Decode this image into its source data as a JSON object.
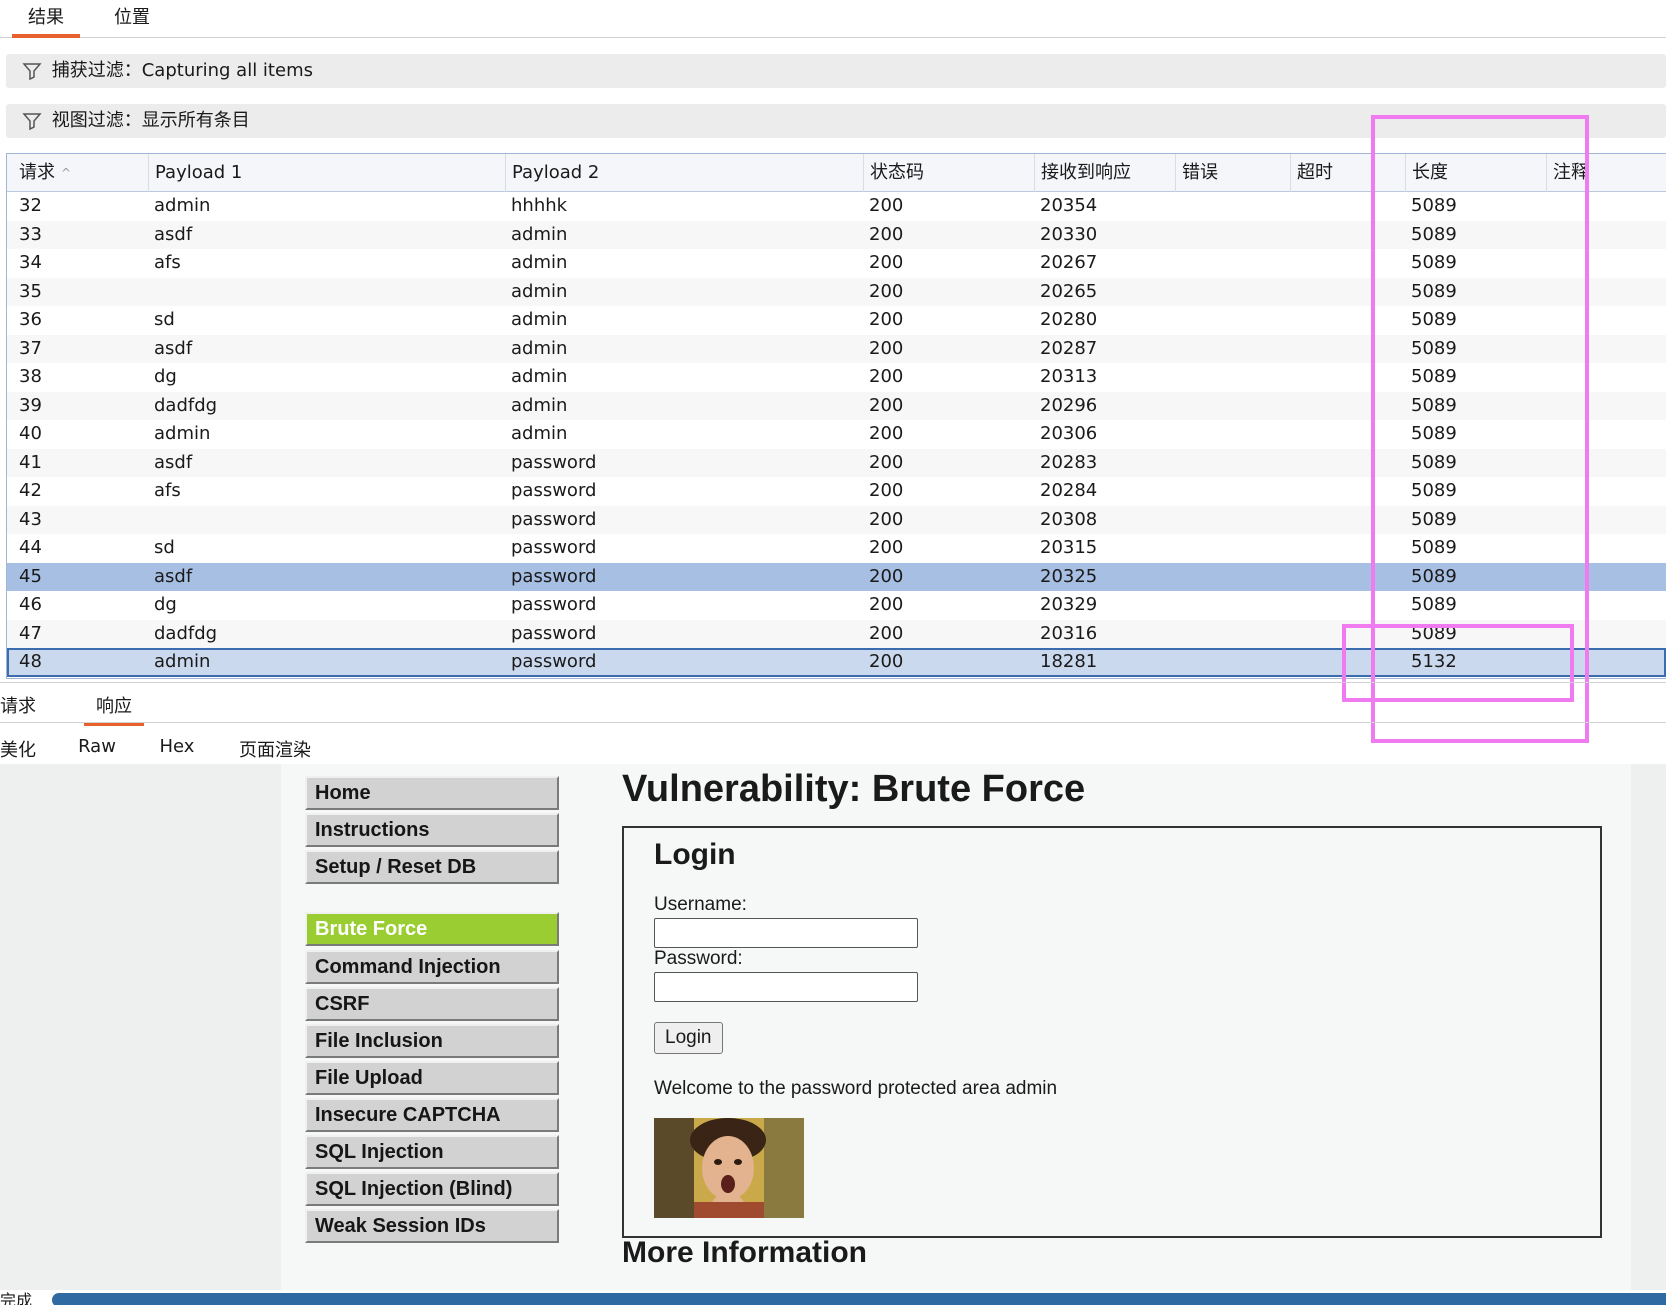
{
  "top_tabs": [
    {
      "label": "结果",
      "active": true
    },
    {
      "label": "位置",
      "active": false
    }
  ],
  "filters": {
    "capture": "捕获过滤：Capturing all items",
    "view": "视图过滤：显示所有条目"
  },
  "table": {
    "columns": [
      "请求",
      "Payload 1",
      "Payload 2",
      "状态码",
      "接收到响应",
      "错误",
      "超时",
      "长度",
      "注释"
    ],
    "sort_indicator": "^",
    "rows": [
      {
        "req": "32",
        "p1": "admin",
        "p2": "hhhhk",
        "status": "200",
        "resp": "20354",
        "len": "5089"
      },
      {
        "req": "33",
        "p1": "asdf",
        "p2": "admin",
        "status": "200",
        "resp": "20330",
        "len": "5089"
      },
      {
        "req": "34",
        "p1": "afs",
        "p2": "admin",
        "status": "200",
        "resp": "20267",
        "len": "5089"
      },
      {
        "req": "35",
        "p1": "",
        "p2": "admin",
        "status": "200",
        "resp": "20265",
        "len": "5089"
      },
      {
        "req": "36",
        "p1": "sd",
        "p2": "admin",
        "status": "200",
        "resp": "20280",
        "len": "5089"
      },
      {
        "req": "37",
        "p1": "asdf",
        "p2": "admin",
        "status": "200",
        "resp": "20287",
        "len": "5089"
      },
      {
        "req": "38",
        "p1": "dg",
        "p2": "admin",
        "status": "200",
        "resp": "20313",
        "len": "5089"
      },
      {
        "req": "39",
        "p1": "dadfdg",
        "p2": "admin",
        "status": "200",
        "resp": "20296",
        "len": "5089"
      },
      {
        "req": "40",
        "p1": "admin",
        "p2": "admin",
        "status": "200",
        "resp": "20306",
        "len": "5089"
      },
      {
        "req": "41",
        "p1": "asdf",
        "p2": "password",
        "status": "200",
        "resp": "20283",
        "len": "5089"
      },
      {
        "req": "42",
        "p1": "afs",
        "p2": "password",
        "status": "200",
        "resp": "20284",
        "len": "5089"
      },
      {
        "req": "43",
        "p1": "",
        "p2": "password",
        "status": "200",
        "resp": "20308",
        "len": "5089"
      },
      {
        "req": "44",
        "p1": "sd",
        "p2": "password",
        "status": "200",
        "resp": "20315",
        "len": "5089"
      },
      {
        "req": "45",
        "p1": "asdf",
        "p2": "password",
        "status": "200",
        "resp": "20325",
        "len": "5089",
        "state": "selected"
      },
      {
        "req": "46",
        "p1": "dg",
        "p2": "password",
        "status": "200",
        "resp": "20329",
        "len": "5089"
      },
      {
        "req": "47",
        "p1": "dadfdg",
        "p2": "password",
        "status": "200",
        "resp": "20316",
        "len": "5089"
      },
      {
        "req": "48",
        "p1": "admin",
        "p2": "password",
        "status": "200",
        "resp": "18281",
        "len": "5132",
        "state": "focused"
      }
    ]
  },
  "pane_tabs": [
    {
      "label": "请求",
      "active": false
    },
    {
      "label": "响应",
      "active": true
    }
  ],
  "view_tabs": [
    {
      "label": "美化",
      "active": false
    },
    {
      "label": "Raw",
      "active": false
    },
    {
      "label": "Hex",
      "active": false
    },
    {
      "label": "页面渲染",
      "active": true
    }
  ],
  "rendered_page": {
    "title": "Vulnerability: Brute Force",
    "menu": [
      "Home",
      "Instructions",
      "Setup / Reset DB",
      "Brute Force",
      "Command Injection",
      "CSRF",
      "File Inclusion",
      "File Upload",
      "Insecure CAPTCHA",
      "SQL Injection",
      "SQL Injection (Blind)",
      "Weak Session IDs"
    ],
    "active_menu": "Brute Force",
    "login": {
      "heading": "Login",
      "username_label": "Username:",
      "password_label": "Password:",
      "button": "Login",
      "welcome": "Welcome to the password protected area admin"
    },
    "more_heading": "More Information"
  },
  "status": {
    "text": "完成"
  },
  "colors": {
    "accent": "#e8602c",
    "highlight": "#f07af0",
    "active_menu": "#9acd32",
    "selected_row": "#a7bfe3"
  },
  "icons": {
    "filter": "funnel-icon",
    "sort": "sort-ascending-icon"
  }
}
